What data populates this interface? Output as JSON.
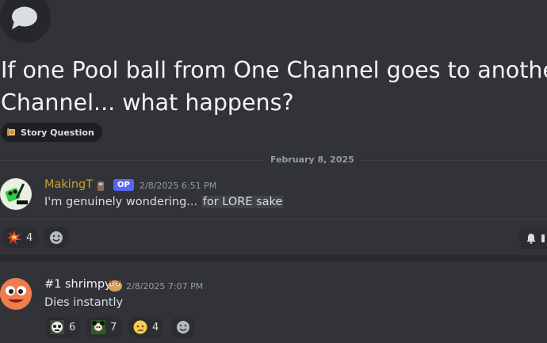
{
  "post": {
    "title_line1": "If one Pool ball from One Channel goes to another",
    "title_line2": "Channel... what happens?",
    "tag_label": "Story Question",
    "date_divider": "February 8, 2025"
  },
  "messages": [
    {
      "author": "MakingT",
      "author_color": "#c9a227",
      "badge": "OP",
      "timestamp": "2/8/2025 6:51 PM",
      "text_plain": "I'm genuinely wondering... ",
      "text_highlight": "for LORE sake",
      "reactions": [
        {
          "emoji": "collision-emoji",
          "count": "4"
        }
      ]
    },
    {
      "author": "#1 shrimpy",
      "author_color": "#f2f3f5",
      "timestamp": "2/8/2025 7:07 PM",
      "text": "Dies instantly",
      "reactions": [
        {
          "emoji": "skull-character-emoji",
          "count": "6"
        },
        {
          "emoji": "character-emoji",
          "count": "7"
        },
        {
          "emoji": "crying-face-emoji",
          "count": "4"
        }
      ]
    }
  ],
  "icons": {
    "thread": "speech-bubble-icon",
    "tag": "scroll-emoji",
    "add_reaction": "smiley-add-reaction-icon",
    "notification": "bell-icon"
  },
  "colors": {
    "background": "#323339",
    "op_badge": "#5865f2",
    "muted": "#949ba4"
  }
}
